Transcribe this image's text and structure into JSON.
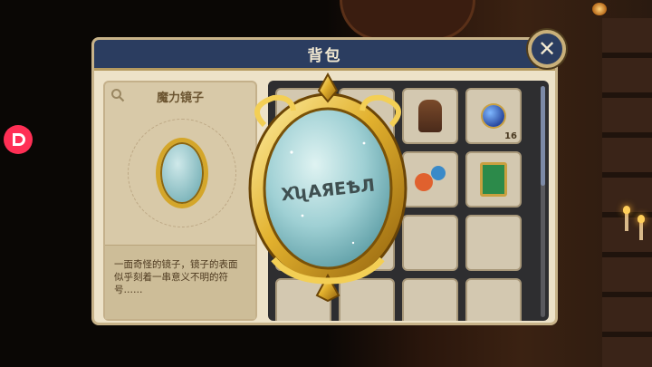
{
  "panel": {
    "title": "背包",
    "close_label": "✕"
  },
  "detail": {
    "item_name": "魔力镜子",
    "description": "一面奇怪的镜子，镜子的表面似乎刻着一串意义不明的符号……",
    "mirror_symbols": "ХʯАЯЕѢЛ"
  },
  "grid": {
    "slots": [
      {
        "icon": "mirror-icon",
        "count": ""
      },
      {
        "icon": "empty",
        "count": ""
      },
      {
        "icon": "figure-icon",
        "count": ""
      },
      {
        "icon": "winged-orb-icon",
        "count": "16"
      },
      {
        "icon": "empty",
        "count": ""
      },
      {
        "icon": "empty",
        "count": ""
      },
      {
        "icon": "planets-icon",
        "count": ""
      },
      {
        "icon": "green-book-icon",
        "count": ""
      },
      {
        "icon": "empty",
        "count": ""
      },
      {
        "icon": "empty",
        "count": ""
      },
      {
        "icon": "empty",
        "count": ""
      },
      {
        "icon": "empty",
        "count": ""
      },
      {
        "icon": "empty",
        "count": ""
      },
      {
        "icon": "empty",
        "count": ""
      },
      {
        "icon": "empty",
        "count": ""
      },
      {
        "icon": "empty",
        "count": ""
      }
    ]
  },
  "colors": {
    "header": "#2b3d60",
    "panel_bg": "#ede2c8",
    "gold": "#d4a62a",
    "badge": "#ff2f55"
  }
}
